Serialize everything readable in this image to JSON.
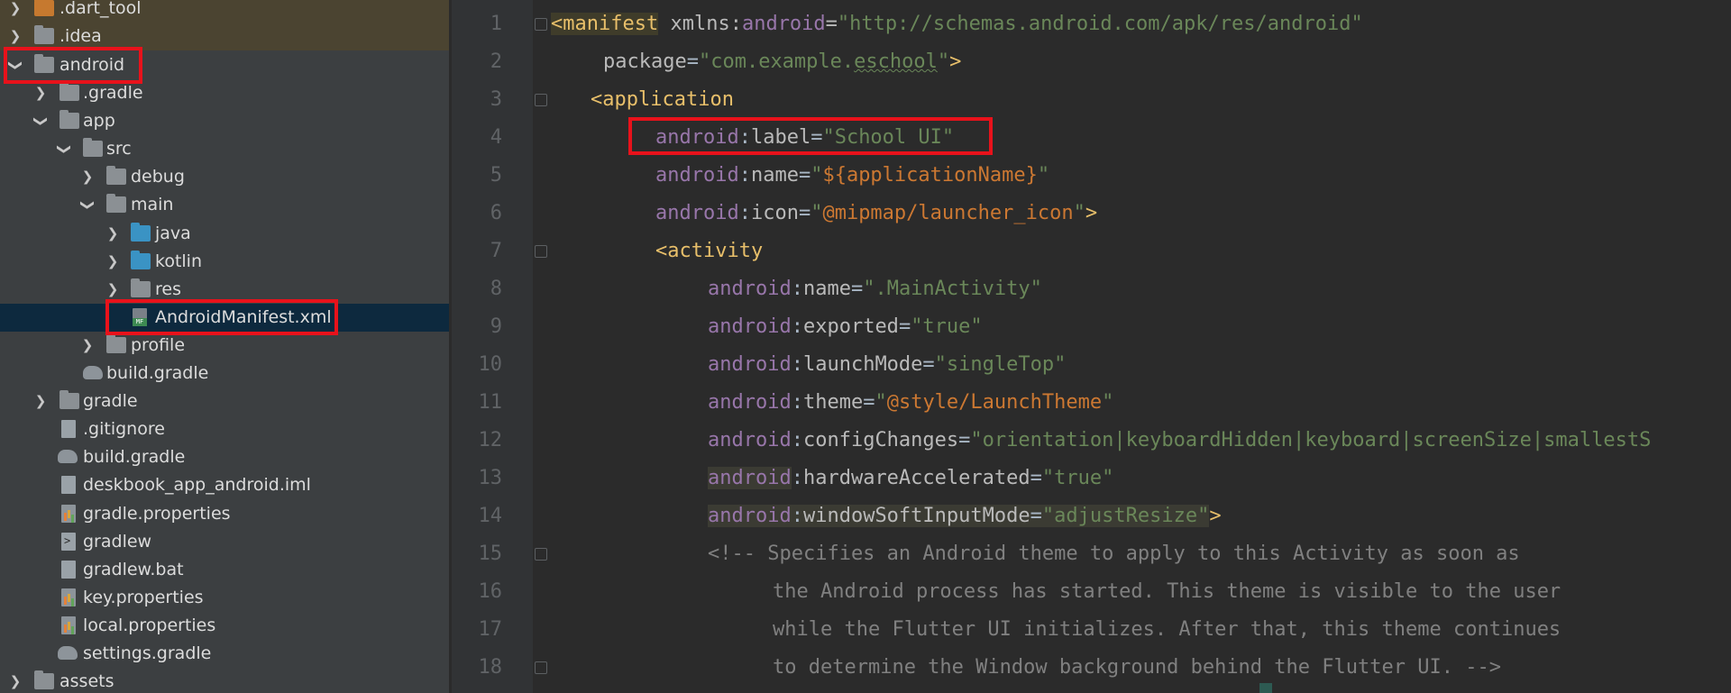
{
  "project_tree": {
    "items": [
      {
        "label": ".dart_tool",
        "expanded": false,
        "icon": "folder-orange-icon"
      },
      {
        "label": ".idea",
        "expanded": false,
        "icon": "folder-settings-icon"
      },
      {
        "label": "android",
        "expanded": true,
        "icon": "folder-android-icon"
      },
      {
        "label": ".gradle",
        "expanded": false,
        "icon": "folder-icon"
      },
      {
        "label": "app",
        "expanded": true,
        "icon": "folder-icon"
      },
      {
        "label": "src",
        "expanded": true,
        "icon": "folder-icon"
      },
      {
        "label": "debug",
        "expanded": false,
        "icon": "folder-icon"
      },
      {
        "label": "main",
        "expanded": true,
        "icon": "folder-icon"
      },
      {
        "label": "java",
        "expanded": false,
        "icon": "folder-source-icon"
      },
      {
        "label": "kotlin",
        "expanded": false,
        "icon": "folder-source-icon"
      },
      {
        "label": "res",
        "expanded": false,
        "icon": "folder-icon"
      },
      {
        "label": "AndroidManifest.xml",
        "selected": true,
        "icon": "manifest-file-icon"
      },
      {
        "label": "profile",
        "expanded": false,
        "icon": "folder-icon"
      },
      {
        "label": "build.gradle",
        "icon": "gradle-file-icon"
      },
      {
        "label": "gradle",
        "expanded": false,
        "icon": "folder-icon"
      },
      {
        "label": ".gitignore",
        "icon": "text-file-icon"
      },
      {
        "label": "build.gradle",
        "icon": "gradle-file-icon"
      },
      {
        "label": "deskbook_app_android.iml",
        "icon": "module-file-icon"
      },
      {
        "label": "gradle.properties",
        "icon": "properties-file-icon"
      },
      {
        "label": "gradlew",
        "icon": "script-file-icon"
      },
      {
        "label": "gradlew.bat",
        "icon": "text-file-icon"
      },
      {
        "label": "key.properties",
        "icon": "properties-file-icon"
      },
      {
        "label": "local.properties",
        "icon": "properties-file-icon"
      },
      {
        "label": "settings.gradle",
        "icon": "gradle-file-icon"
      },
      {
        "label": "assets",
        "expanded": false,
        "icon": "folder-icon"
      }
    ]
  },
  "editor": {
    "line_numbers": [
      "1",
      "2",
      "3",
      "4",
      "5",
      "6",
      "7",
      "8",
      "9",
      "10",
      "11",
      "12",
      "13",
      "14",
      "15",
      "16",
      "17",
      "18"
    ],
    "lines": [
      "<manifest xmlns:android=\"http://schemas.android.com/apk/res/android\"",
      "    package=\"com.example.eschool\">",
      "   <application",
      "        android:label=\"School UI\"",
      "        android:name=\"${applicationName}\"",
      "        android:icon=\"@mipmap/launcher_icon\">",
      "        <activity",
      "            android:name=\".MainActivity\"",
      "            android:exported=\"true\"",
      "            android:launchMode=\"singleTop\"",
      "            android:theme=\"@style/LaunchTheme\"",
      "            android:configChanges=\"orientation|keyboardHidden|keyboard|screenSize|smallestS",
      "            android:hardwareAccelerated=\"true\"",
      "            android:windowSoftInputMode=\"adjustResize\">",
      "            <!-- Specifies an Android theme to apply to this Activity as soon as",
      "                 the Android process has started. This theme is visible to the user",
      "                 while the Flutter UI initializes. After that, this theme continues",
      "                 to determine the Window background behind the Flutter UI. -->"
    ]
  },
  "colors": {
    "tree_bg": "#3c3f41",
    "editor_bg": "#2b2b2b",
    "selection_bg": "#0d293e",
    "highlight_box": "#e8121b",
    "xml_tag": "#e8bf6a",
    "xml_namespace": "#9876aa",
    "xml_value": "#6a8759",
    "comment": "#808080"
  }
}
